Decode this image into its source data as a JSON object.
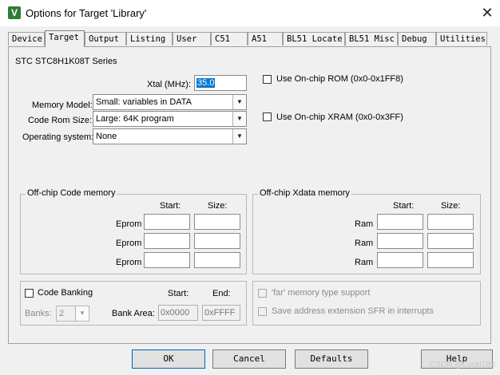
{
  "window": {
    "title": "Options for Target 'Library'",
    "close_glyph": "✕"
  },
  "tabs": [
    "Device",
    "Target",
    "Output",
    "Listing",
    "User",
    "C51",
    "A51",
    "BL51 Locate",
    "BL51 Misc",
    "Debug",
    "Utilities"
  ],
  "device": {
    "series": "STC STC8H1K08T Series"
  },
  "xtal": {
    "label": "Xtal (MHz):",
    "value": "35.0"
  },
  "memory_model": {
    "label": "Memory Model:",
    "value": "Small: variables in DATA"
  },
  "code_rom": {
    "label": "Code Rom Size:",
    "value": "Large: 64K program"
  },
  "os": {
    "label": "Operating system:",
    "value": "None"
  },
  "onchip_rom": {
    "label": "Use On-chip ROM (0x0-0x1FF8)"
  },
  "onchip_xram": {
    "label": "Use On-chip XRAM (0x0-0x3FF)"
  },
  "offchip_code": {
    "title": "Off-chip Code memory",
    "start_label": "Start:",
    "size_label": "Size:",
    "rows": [
      "Eprom",
      "Eprom",
      "Eprom"
    ]
  },
  "offchip_xdata": {
    "title": "Off-chip Xdata memory",
    "start_label": "Start:",
    "size_label": "Size:",
    "rows": [
      "Ram",
      "Ram",
      "Ram"
    ]
  },
  "banking": {
    "code_banking_label": "Code Banking",
    "start_label": "Start:",
    "end_label": "End:",
    "banks_label": "Banks:",
    "banks_value": "2",
    "bank_area_label": "Bank Area:",
    "bank_start": "0x0000",
    "bank_end": "0xFFFF"
  },
  "far_memory": {
    "label": "'far' memory type support"
  },
  "save_sfr": {
    "label": "Save address extension SFR in interrupts"
  },
  "buttons": {
    "ok": "OK",
    "cancel": "Cancel",
    "defaults": "Defaults",
    "help": "Help"
  },
  "watermark": "CSDN @Lucki1Bit",
  "icons": {
    "app": "keil-uvision-icon",
    "arrow": "▼"
  }
}
